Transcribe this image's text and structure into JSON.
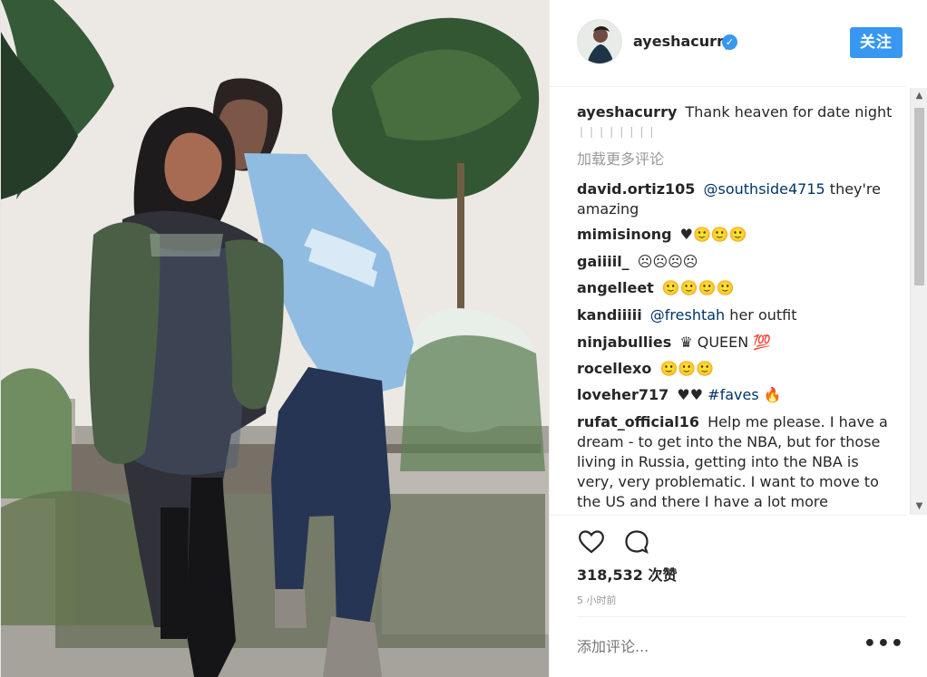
{
  "header": {
    "username": "ayeshacurry",
    "verified_symbol": "✓",
    "follow_label": "关注"
  },
  "post": {
    "caption_user": "ayeshacurry",
    "caption_text": "Thank heaven for date night",
    "caption_dots": "❘❘❘❘❘❘❘❘",
    "load_more": "加载更多评论",
    "comments": [
      {
        "user": "david.ortiz105",
        "mention": "@southside4715",
        "text": "they're amazing"
      },
      {
        "user": "mimisinong",
        "text": "♥🙂🙂🙂"
      },
      {
        "user": "gaiiiil_",
        "text": "☹☹☹☹"
      },
      {
        "user": "angelleet",
        "text": "🙂🙂🙂🙂"
      },
      {
        "user": "kandiiiii",
        "mention": "@freshtah",
        "text": "her outfit"
      },
      {
        "user": "ninjabullies",
        "text": "♛ QUEEN 💯"
      },
      {
        "user": "rocellexo",
        "text": "🙂🙂🙂"
      },
      {
        "user": "loveher717",
        "text": "♥♥",
        "mention": "#faves",
        "extra": "🔥"
      },
      {
        "user": "rufat_official16",
        "text": "Help me please. I have a dream - to get into the NBA, but for those living in Russia, getting into the NBA is very, very problematic. I want to move to the US and there I have a lot more chances."
      }
    ],
    "likes": "318,532 次赞",
    "time": "5 小时前",
    "add_comment_placeholder": "添加评论...",
    "more_symbol": "•••"
  },
  "icons": {
    "heart": "heart-icon",
    "comment": "comment-icon",
    "verified": "verified-icon",
    "more": "more-icon"
  },
  "colors": {
    "primary_blue": "#3897f0",
    "text_dark": "#262626",
    "muted_text": "#999999",
    "mention_blue": "#003569",
    "divider": "#efefef"
  }
}
